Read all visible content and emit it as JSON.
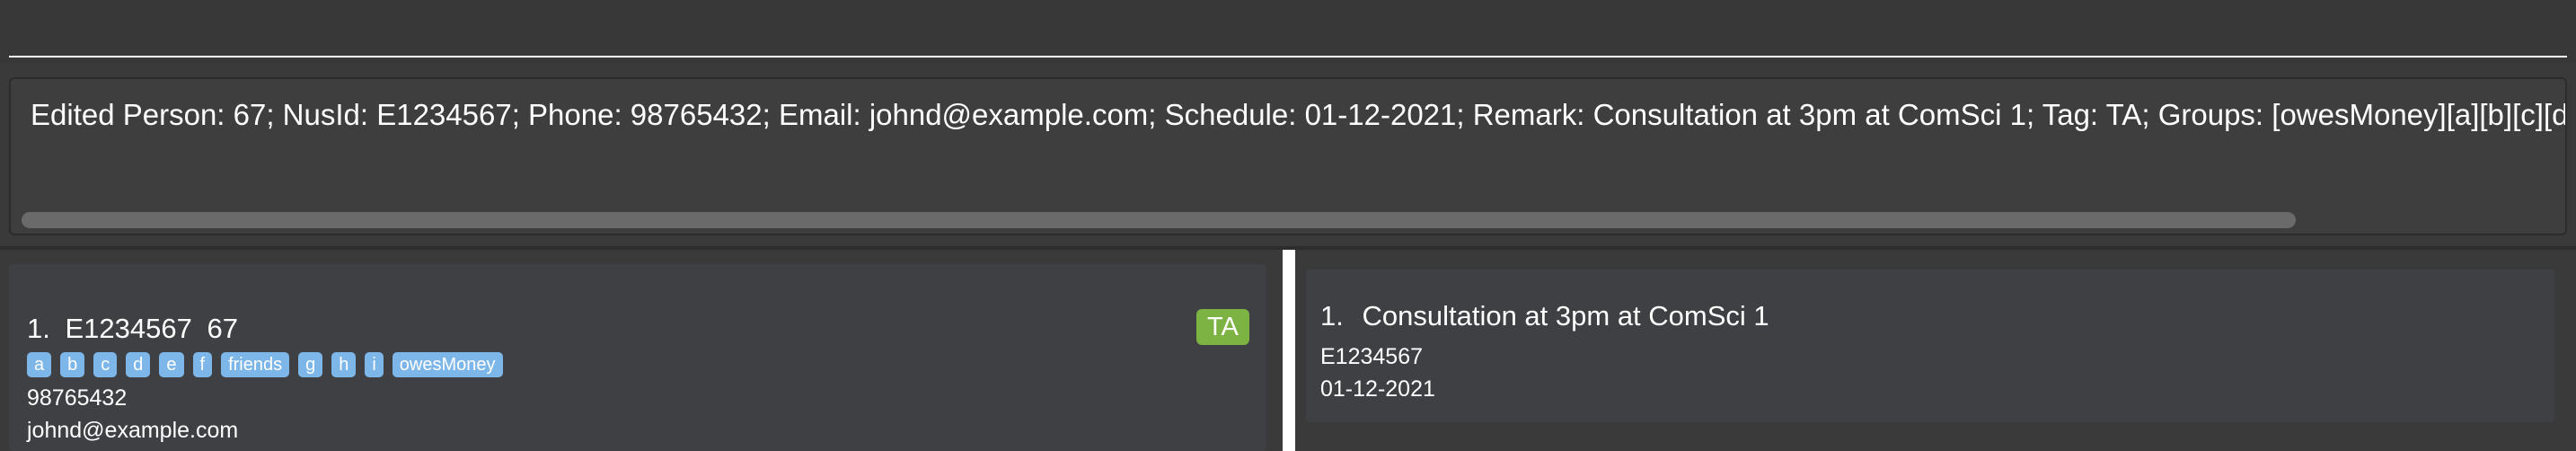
{
  "command_box": {
    "value": "",
    "placeholder": ""
  },
  "result_display": {
    "text": "Edited Person: 67; NusId: E1234567; Phone: 98765432; Email: johnd@example.com; Schedule: 01-12-2021; Remark: Consultation at 3pm at ComSci 1; Tag: TA; Groups: [owesMoney][a][b][c][d]"
  },
  "person_list": {
    "items": [
      {
        "index": "1.",
        "nus_id": "E1234567",
        "name": "67",
        "tag": "TA",
        "groups": [
          "a",
          "b",
          "c",
          "d",
          "e",
          "f",
          "friends",
          "g",
          "h",
          "i",
          "owesMoney"
        ],
        "phone": "98765432",
        "email": "johnd@example.com"
      }
    ]
  },
  "schedule_list": {
    "items": [
      {
        "index": "1.",
        "remark": "Consultation at 3pm at ComSci 1",
        "nus_id": "E1234567",
        "date": "01-12-2021"
      }
    ]
  },
  "colors": {
    "background": "#3a3a3a",
    "card": "#3e4043",
    "tag": "#7cb342",
    "group_chip": "#7db6e8"
  }
}
